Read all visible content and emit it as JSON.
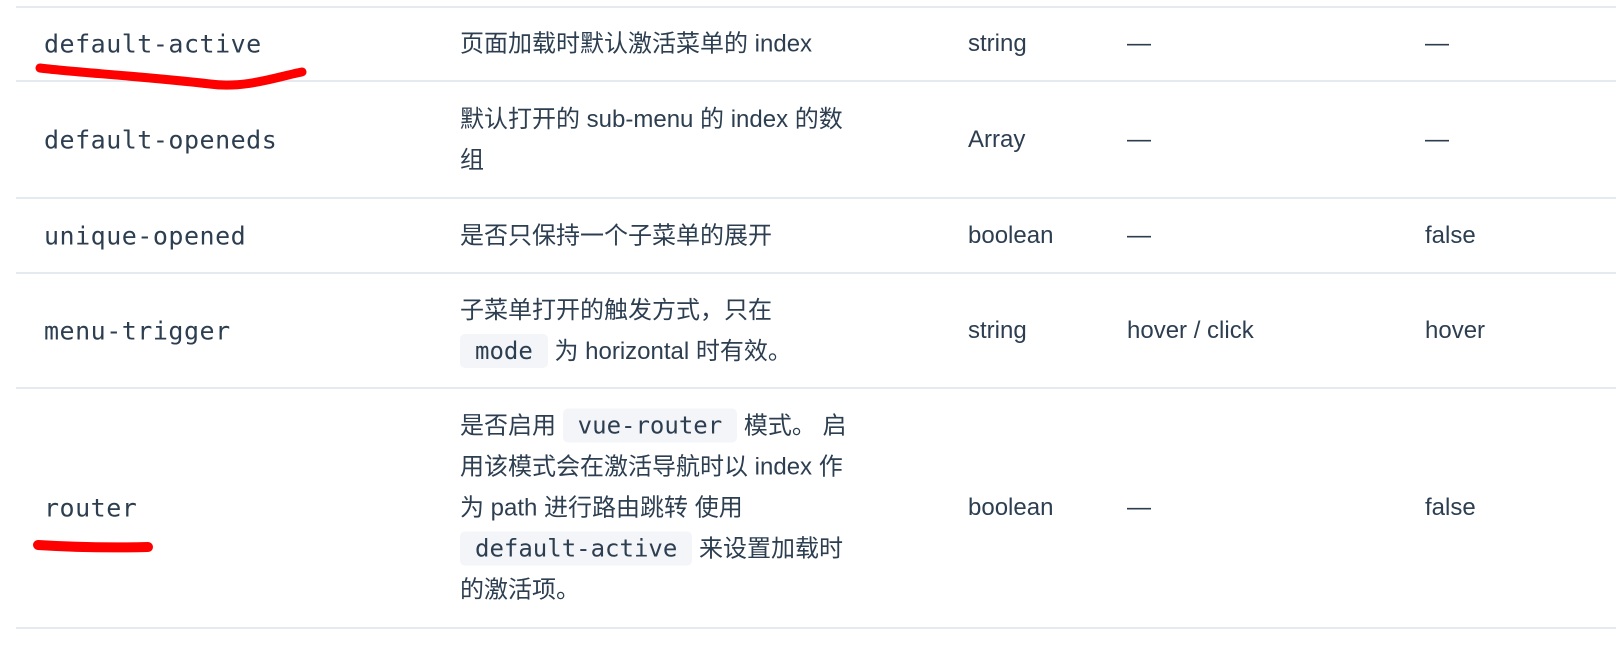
{
  "rows": [
    {
      "name": "default-active",
      "description": "页面加载时默认激活菜单的 index",
      "type": "string",
      "options": "—",
      "default": "—"
    },
    {
      "name": "default-openeds",
      "description_line1": "默认打开的 sub-menu 的 index 的数",
      "description_line2": "组",
      "type": "Array",
      "options": "—",
      "default": "—"
    },
    {
      "name": "unique-opened",
      "description": "是否只保持一个子菜单的展开",
      "type": "boolean",
      "options": "—",
      "default": "false"
    },
    {
      "name": "menu-trigger",
      "description_line1": "子菜单打开的触发方式，只在",
      "description_code": "mode",
      "description_line2_suffix": " 为 horizontal 时有效。",
      "type": "string",
      "options": "hover / click",
      "default": "hover"
    },
    {
      "name": "router",
      "description_part1": "是否启用 ",
      "description_code1": "vue-router",
      "description_part2": " 模式。 启",
      "description_line2": "用该模式会在激活导航时以 index 作",
      "description_line3": "为 path 进行路由跳转 使用",
      "description_code2": "default-active",
      "description_part3": " 来设置加载时",
      "description_line5": "的激活项。",
      "type": "boolean",
      "options": "—",
      "default": "false"
    }
  ],
  "annotation_color": "#ff0000",
  "border_color": "#e5e9f0",
  "code_background": "#f3f5f8"
}
